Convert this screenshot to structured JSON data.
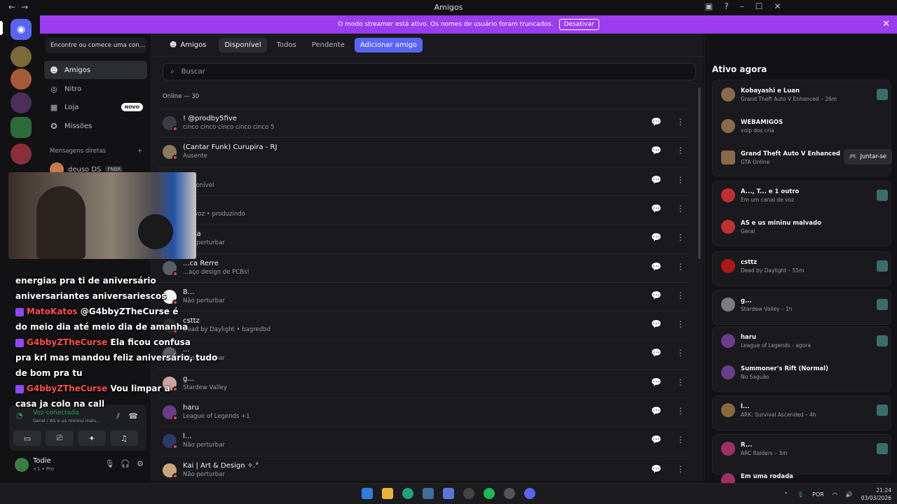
{
  "window": {
    "title": "Amigos"
  },
  "banner": {
    "text": "O modo streamer está ativo. Os nomes de usuário foram truncados.",
    "button": "Desativar"
  },
  "sidebar": {
    "search_placeholder": "Encontre ou comece uma con...",
    "items": [
      {
        "label": "Amigos",
        "icon": "friends-icon"
      },
      {
        "label": "Nitro",
        "icon": "nitro-icon"
      },
      {
        "label": "Loja",
        "icon": "shop-icon",
        "badge": "NOVO"
      },
      {
        "label": "Missões",
        "icon": "quests-icon"
      }
    ],
    "dm_header": "Mensagens diretas",
    "dm_add": "+",
    "dm_first": "deuso DS",
    "dm_first_tag": "FNBR"
  },
  "voice": {
    "status": "Voz conectada",
    "channel": "Geral / AS e us mininu malv..."
  },
  "user": {
    "name": "Todie",
    "status": "+1 • Pro"
  },
  "overlay_chat": [
    {
      "user": "",
      "text": "energias pra ti de aniversário"
    },
    {
      "user": "",
      "text": "aniversariantes aniversariescos"
    },
    {
      "user": "MatoKatos",
      "text": "@G4bbyZTheCurse é"
    },
    {
      "user": "",
      "text": "do meio dia até meio dia de amanha"
    },
    {
      "user": "G4bbyZTheCurse",
      "text": "Ela ficou confusa"
    },
    {
      "user": "",
      "text": "pra krl mas mandou feliz aniversário, tudo"
    },
    {
      "user": "",
      "text": "de bom pra tu"
    },
    {
      "user": "G4bbyZTheCurse",
      "text": "Vou limpar a"
    },
    {
      "user": "",
      "text": "casa ja colo na call"
    }
  ],
  "header": {
    "title": "Amigos",
    "tabs": [
      "Disponível",
      "Todos",
      "Pendente"
    ],
    "add_friend": "Adicionar amigo"
  },
  "friends": {
    "search_placeholder": "Buscar",
    "online_count": "Online — 30",
    "rows": [
      {
        "name": "! @prodby5five",
        "status": "cinco cinco cinco cinco cinco 5",
        "avatar_color": "#3a3d44"
      },
      {
        "name": "(Cantar Funk) Curupira - RJ",
        "status": "Ausente",
        "avatar_color": "#8a7b5c"
      },
      {
        "name": "...ie",
        "status": "Disponível",
        "avatar_color": "#5a5d66"
      },
      {
        "name": "...",
        "status": "Em voz • produzindo",
        "avatar_color": "#5a5d66"
      },
      {
        "name": "...ata",
        "status": "Não perturbar",
        "avatar_color": "#5a5d66"
      },
      {
        "name": "...ca Rerre",
        "status": "...aço design de PCBs!",
        "avatar_color": "#5a5d66"
      },
      {
        "name": "B...",
        "status": "Não perturbar",
        "avatar_color": "#f2f3f5"
      },
      {
        "name": "csttz",
        "status": "Dead by Daylight • bagredbd",
        "avatar_color": "#2b2d31"
      },
      {
        "name": "...",
        "status": "Não perturbar",
        "avatar_color": "#5a5d66"
      },
      {
        "name": "g...",
        "status": "Stardew Valley",
        "avatar_color": "#c9a6a0"
      },
      {
        "name": "haru",
        "status": "League of Legends +1",
        "avatar_color": "#6a3d8a"
      },
      {
        "name": "l...",
        "status": "Não perturbar",
        "avatar_color": "#2c3a6b"
      },
      {
        "name": "Kai | Art & Design ✧.°",
        "status": "Não perturbar",
        "avatar_color": "#c9a67a"
      }
    ]
  },
  "active_now": {
    "title": "Ativo agora",
    "cards": [
      {
        "items": [
          {
            "name": "Kobayashi e Luan",
            "sub": "Grand Theft Auto V Enhanced – 26m"
          },
          {
            "name": "WEBAMIGOS",
            "sub": "voip dos cria"
          },
          {
            "name": "Grand Theft Auto V Enhanced",
            "sub": "GTA Online",
            "button": "Juntar-se"
          }
        ]
      },
      {
        "items": [
          {
            "name": "A..., T... e 1 outro",
            "sub": "Em um canal de voz"
          },
          {
            "name": "AS e us mininu malvado",
            "sub": "Geral"
          }
        ]
      },
      {
        "items": [
          {
            "name": "csttz",
            "sub": "Dead by Daylight – 55m"
          }
        ]
      },
      {
        "items": [
          {
            "name": "g...",
            "sub": "Stardew Valley – 1h"
          }
        ]
      },
      {
        "items": [
          {
            "name": "haru",
            "sub": "League of Legends - agora"
          },
          {
            "name": "Summoner's Rift (Normal)",
            "sub": "No Saguão"
          }
        ]
      },
      {
        "items": [
          {
            "name": "l...",
            "sub": "ARK: Survival Ascended – 4h"
          }
        ]
      },
      {
        "items": [
          {
            "name": "R...",
            "sub": "ARC Raiders – 3m"
          },
          {
            "name": "Em uma rodada",
            "sub": ""
          }
        ]
      }
    ]
  },
  "taskbar": {
    "lang": "POR",
    "time": "21:24",
    "date": "03/03/2026"
  }
}
